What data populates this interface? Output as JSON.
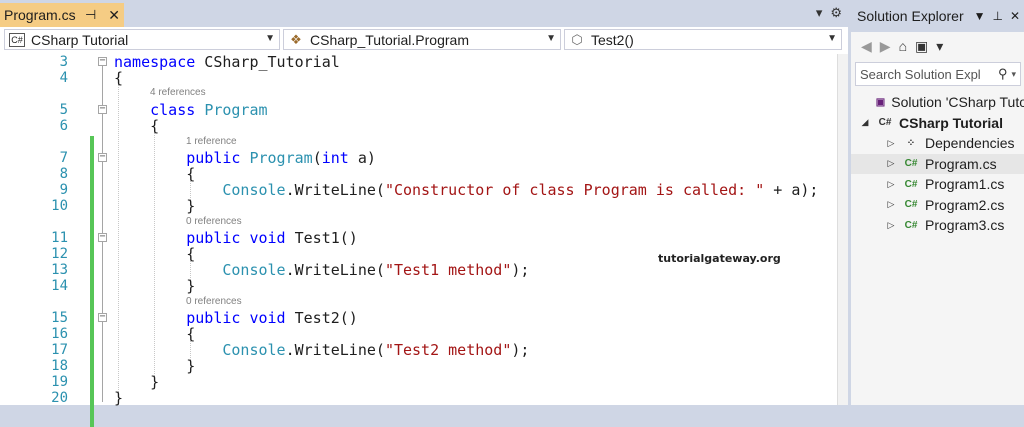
{
  "editor": {
    "tab_title": "Program.cs",
    "pin_icon": "pin-icon",
    "close_icon": "close-icon",
    "nav": {
      "project_badge": "C#",
      "project": "CSharp Tutorial",
      "class": "CSharp_Tutorial.Program",
      "member": "Test2()"
    },
    "lines": [
      {
        "num": "3",
        "code": [
          {
            "t": "namespace",
            "c": "kw"
          },
          {
            "t": " CSharp_Tutorial",
            "c": ""
          }
        ]
      },
      {
        "num": "4",
        "code": [
          {
            "t": "{",
            "c": ""
          }
        ]
      },
      {
        "num": "5",
        "code": [
          {
            "t": "    ",
            "c": ""
          },
          {
            "t": "class",
            "c": "kw"
          },
          {
            "t": " ",
            "c": ""
          },
          {
            "t": "Program",
            "c": "ty"
          }
        ]
      },
      {
        "num": "6",
        "code": [
          {
            "t": "    {",
            "c": ""
          }
        ]
      },
      {
        "num": "7",
        "code": [
          {
            "t": "        ",
            "c": ""
          },
          {
            "t": "public",
            "c": "kw"
          },
          {
            "t": " ",
            "c": ""
          },
          {
            "t": "Program",
            "c": "ty"
          },
          {
            "t": "(",
            "c": ""
          },
          {
            "t": "int",
            "c": "kw"
          },
          {
            "t": " a)",
            "c": ""
          }
        ]
      },
      {
        "num": "8",
        "code": [
          {
            "t": "        {",
            "c": ""
          }
        ]
      },
      {
        "num": "9",
        "code": [
          {
            "t": "            ",
            "c": ""
          },
          {
            "t": "Console",
            "c": "ty"
          },
          {
            "t": ".WriteLine(",
            "c": ""
          },
          {
            "t": "\"Constructor of class Program is called: \"",
            "c": "str"
          },
          {
            "t": " + a);",
            "c": ""
          }
        ]
      },
      {
        "num": "10",
        "code": [
          {
            "t": "        }",
            "c": ""
          }
        ]
      },
      {
        "num": "11",
        "code": [
          {
            "t": "        ",
            "c": ""
          },
          {
            "t": "public",
            "c": "kw"
          },
          {
            "t": " ",
            "c": ""
          },
          {
            "t": "void",
            "c": "kw"
          },
          {
            "t": " Test1()",
            "c": ""
          }
        ]
      },
      {
        "num": "12",
        "code": [
          {
            "t": "        {",
            "c": ""
          }
        ]
      },
      {
        "num": "13",
        "code": [
          {
            "t": "            ",
            "c": ""
          },
          {
            "t": "Console",
            "c": "ty"
          },
          {
            "t": ".WriteLine(",
            "c": ""
          },
          {
            "t": "\"Test1 method\"",
            "c": "str"
          },
          {
            "t": ");",
            "c": ""
          }
        ]
      },
      {
        "num": "14",
        "code": [
          {
            "t": "        }",
            "c": ""
          }
        ]
      },
      {
        "num": "15",
        "code": [
          {
            "t": "        ",
            "c": ""
          },
          {
            "t": "public",
            "c": "kw"
          },
          {
            "t": " ",
            "c": ""
          },
          {
            "t": "void",
            "c": "kw"
          },
          {
            "t": " Test2()",
            "c": ""
          }
        ]
      },
      {
        "num": "16",
        "code": [
          {
            "t": "        {",
            "c": ""
          }
        ]
      },
      {
        "num": "17",
        "code": [
          {
            "t": "            ",
            "c": ""
          },
          {
            "t": "Console",
            "c": "ty"
          },
          {
            "t": ".WriteLine(",
            "c": ""
          },
          {
            "t": "\"Test2 method\"",
            "c": "str"
          },
          {
            "t": ");",
            "c": ""
          }
        ]
      },
      {
        "num": "18",
        "code": [
          {
            "t": "        }",
            "c": ""
          }
        ]
      },
      {
        "num": "19",
        "code": [
          {
            "t": "    }",
            "c": ""
          }
        ]
      },
      {
        "num": "20",
        "code": [
          {
            "t": "}",
            "c": ""
          }
        ]
      }
    ],
    "lenses": {
      "class_refs": "4 references",
      "ctor_refs": "1 reference",
      "test1_refs": "0 references",
      "test2_refs": "0 references"
    },
    "watermark": "tutorialgateway.org"
  },
  "solution_explorer": {
    "title": "Solution Explorer",
    "search_placeholder": "Search Solution Expl",
    "items": [
      {
        "label": "Solution 'CSharp Tuto",
        "icon": "solution-icon",
        "glyph": "▣",
        "cs": false,
        "exp": "",
        "bold": false
      },
      {
        "label": "CSharp Tutorial",
        "icon": "csharp-project-icon",
        "glyph": "C#",
        "cs": false,
        "exp": "◢",
        "bold": true
      },
      {
        "label": "Dependencies",
        "icon": "dependencies-icon",
        "glyph": "⁘",
        "cs": false,
        "exp": "▷",
        "bold": false
      },
      {
        "label": "Program.cs",
        "icon": "csharp-file-icon",
        "glyph": "C#",
        "cs": true,
        "exp": "▷",
        "bold": false,
        "selected": true
      },
      {
        "label": "Program1.cs",
        "icon": "csharp-file-icon",
        "glyph": "C#",
        "cs": true,
        "exp": "▷",
        "bold": false
      },
      {
        "label": "Program2.cs",
        "icon": "csharp-file-icon",
        "glyph": "C#",
        "cs": true,
        "exp": "▷",
        "bold": false
      },
      {
        "label": "Program3.cs",
        "icon": "csharp-file-icon",
        "glyph": "C#",
        "cs": true,
        "exp": "▷",
        "bold": false
      }
    ]
  },
  "colors": {
    "active_tab": "#f5cc84",
    "keyword": "#0000ff",
    "type": "#2b91af",
    "string": "#a31515",
    "change_bar": "#57c657",
    "frame": "#cfd6e5"
  }
}
